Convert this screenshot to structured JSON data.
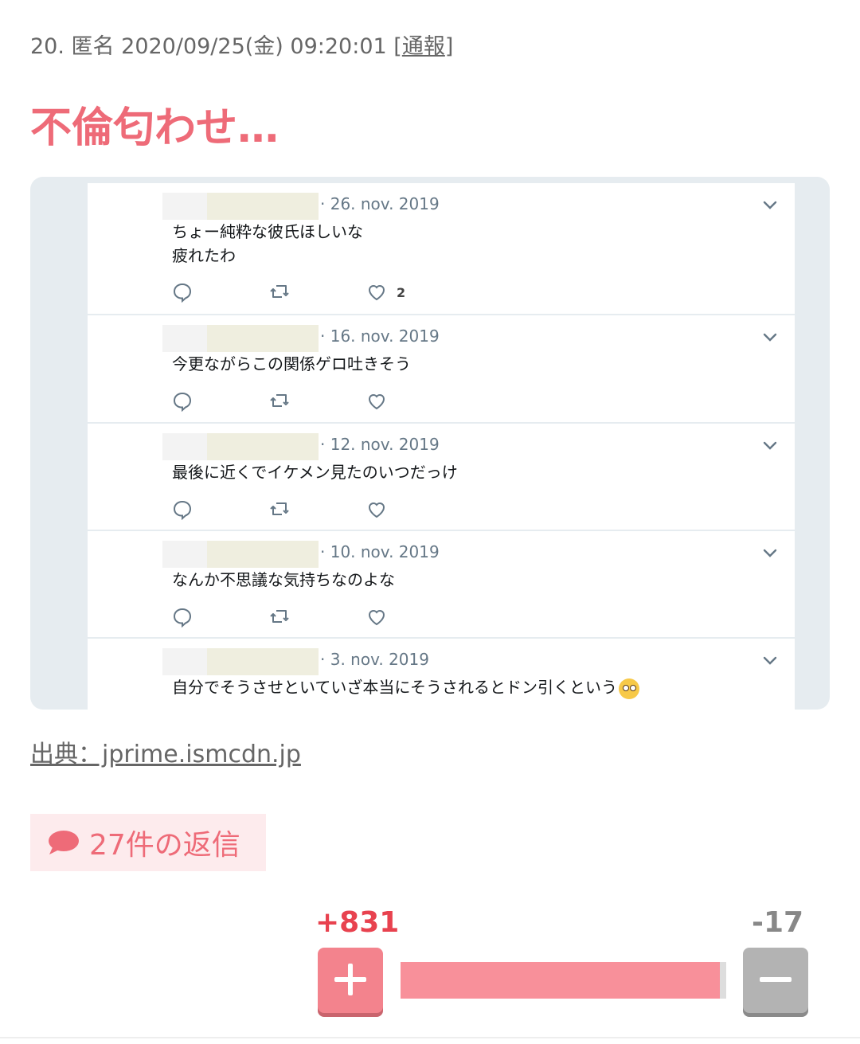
{
  "post": {
    "number": "20.",
    "author": "匿名",
    "timestamp": "2020/09/25(金) 09:20:01",
    "report_open": "[",
    "report_label": "通報",
    "report_close": "]",
    "title": "不倫匂わせ…"
  },
  "tweets": [
    {
      "date": "· 26. nov. 2019",
      "lines": [
        "ちょー純粋な彼氏ほしいな",
        "疲れたわ"
      ],
      "like_count": "2"
    },
    {
      "date": "· 16. nov. 2019",
      "lines": [
        "今更ながらこの関係ゲロ吐きそう"
      ],
      "like_count": ""
    },
    {
      "date": "· 12. nov. 2019",
      "lines": [
        "最後に近くでイケメン見たのいつだっけ"
      ],
      "like_count": ""
    },
    {
      "date": "· 10. nov. 2019",
      "lines": [
        "なんか不思議な気持ちなのよな"
      ],
      "like_count": ""
    },
    {
      "date": "· 3. nov. 2019",
      "lines": [
        "自分でそうさせといていざ本当にそうされるとドン引くという"
      ],
      "like_count": ""
    }
  ],
  "icons": {
    "reply": "speech-bubble-icon",
    "retweet": "retweet-icon",
    "like": "heart-icon",
    "caret": "chevron-down-icon",
    "emoji": "flushed-face-emoji"
  },
  "source": {
    "label": "出典：jprime.ismcdn.jp"
  },
  "replies": {
    "label": "27件の返信"
  },
  "votes": {
    "plus_label": "+831",
    "minus_label": "-17",
    "plus": 831,
    "minus": 17,
    "plus_fraction": 0.98
  },
  "colors": {
    "accent": "#ee6b78",
    "plus": "#e8424f",
    "minus": "#888888",
    "bar_fill": "#f8909a"
  }
}
